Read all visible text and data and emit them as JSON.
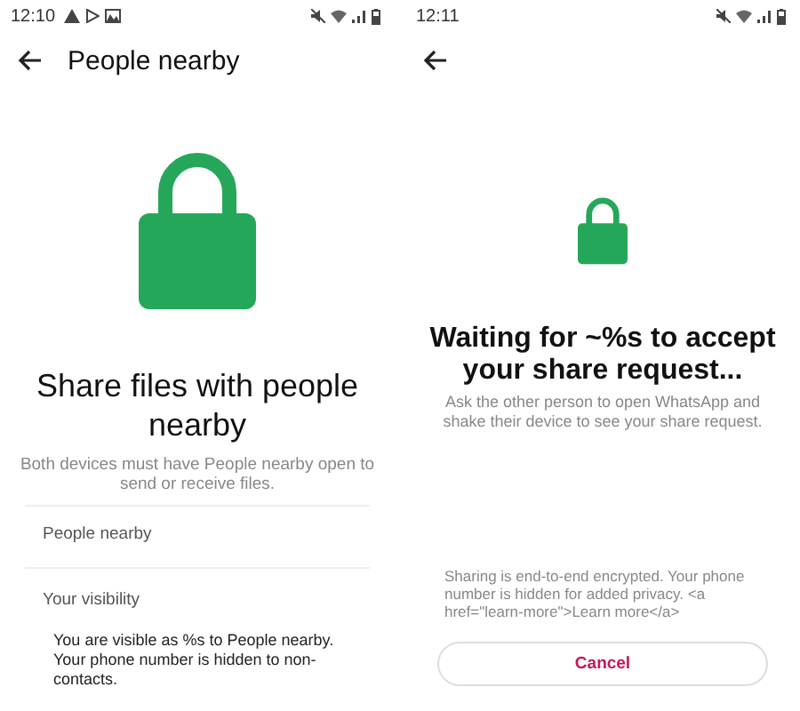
{
  "screens": [
    {
      "kind": "intro",
      "status_time": "12:10",
      "title": "People nearby",
      "heading": "Share files with people nearby",
      "subtitle": "Both devices must have People nearby open to send or receive files.",
      "rows": [
        {
          "label": "People nearby"
        }
      ],
      "section_label": "Your visibility",
      "body": "You are visible as %s to People nearby. Your phone number is hidden to non-contacts."
    },
    {
      "kind": "waiting",
      "status_time": "12:11",
      "heading": "Waiting for ~%s to accept your share request...",
      "subtitle": "Ask the other person to open WhatsApp and shake their device to see your share request.",
      "footer": "Sharing is end-to-end encrypted. Your phone number is hidden for added privacy. <a href=\"learn-more\">Learn more</a>",
      "button": "Cancel"
    }
  ]
}
